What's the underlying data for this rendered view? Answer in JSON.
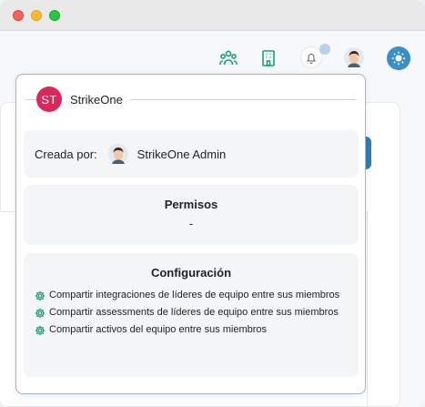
{
  "window": {
    "controls": [
      "close",
      "minimize",
      "maximize"
    ]
  },
  "topbar": {
    "icons": [
      "team-icon",
      "building-icon",
      "bell-icon",
      "user-avatar",
      "sun-icon"
    ],
    "accent_color": "#3a8fc6",
    "icon_color": "#1f9d74"
  },
  "popover": {
    "team_initials": "ST",
    "team_name": "StrikeOne",
    "badge_color": "#d9285c",
    "creator": {
      "label": "Creada por:",
      "name": "StrikeOne Admin"
    },
    "permissions": {
      "title": "Permisos",
      "value": "-"
    },
    "configuration": {
      "title": "Configuración",
      "items": [
        "Compartir integraciones de líderes de equipo entre sus miembros",
        "Compartir assessments de líderes de equipo entre sus miembros",
        "Compartir activos del equipo entre sus miembros"
      ]
    }
  }
}
